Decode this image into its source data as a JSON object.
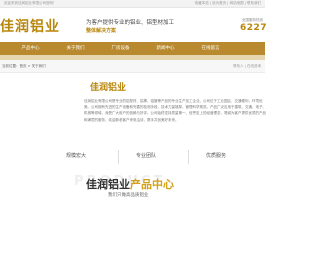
{
  "topbar": {
    "welcome": "欢迎来到佳润铝业有限公司官网！",
    "links": "收藏本站 | 设为首页 | 网站地图 | 联系我们"
  },
  "header": {
    "logo": "佳润铝业",
    "slogan_main": "为客户提供专业的铝业、铝型材加工",
    "slogan_sub": "整体解决方案",
    "phone_label": "全国服务热线",
    "phone_number": "6227"
  },
  "nav": {
    "items": [
      "产品中心",
      "关于我们",
      "厂房设备",
      "新闻中心",
      "在线留言"
    ]
  },
  "breadcrumb": {
    "text": "当前位置：首页 > 关于我们",
    "side": "联系人 | 在线咨询"
  },
  "about": {
    "title": "佳润铝业",
    "text": "佳润铝业有限公司是专业的铝型材、铝棒、铝管等产品的专业生产加工企业。公司位于工业园区，交通便利，环境优美。公司拥有先进的生产设备和完善的检测手段，技术力量雄厚，管理科学规范。产品广泛应用于建筑、交通、电子、机械等领域，深受广大用户的信赖与好评。公司始终坚持质量第一、信誉至上的经营理念，竭诚为客户提供优质的产品和满意的服务，欢迎新老客户来电洽谈，携手共创美好未来。"
  },
  "features": [
    "规模宏大",
    "专业团队",
    "优质服务"
  ],
  "products": {
    "en_watermark": "PRODUCT",
    "title_main": "佳润铝业",
    "title_accent": "产品中心",
    "subtitle": "我们只做高品质铝业"
  }
}
